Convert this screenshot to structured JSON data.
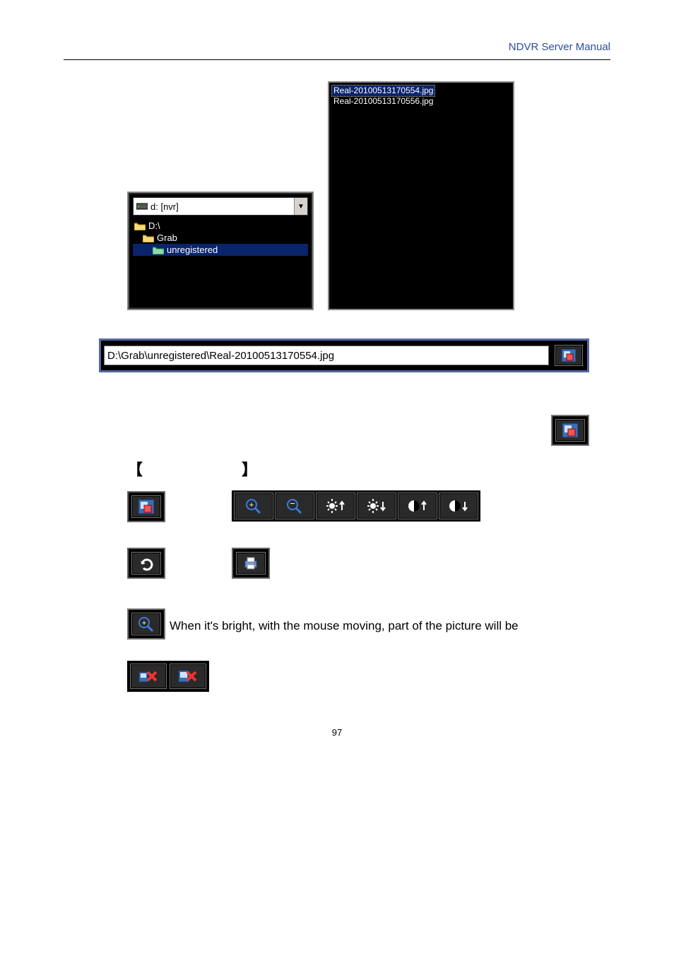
{
  "header": {
    "title": "NDVR Server Manual"
  },
  "drive_panel": {
    "selected_drive": "d: [nvr]",
    "tree": {
      "root": "D:\\",
      "child1": "Grab",
      "child2": "unregistered"
    }
  },
  "file_panel": {
    "files": [
      {
        "name": "Real-20100513170554.jpg",
        "selected": true
      },
      {
        "name": "Real-20100513170556.jpg",
        "selected": false
      }
    ]
  },
  "path_bar": {
    "value": "D:\\Grab\\unregistered\\Real-20100513170554.jpg"
  },
  "brackets": {
    "left": "【",
    "right": "】"
  },
  "zoom_text": "When it's bright, with the mouse moving, part of the picture will be",
  "page_number": "97"
}
